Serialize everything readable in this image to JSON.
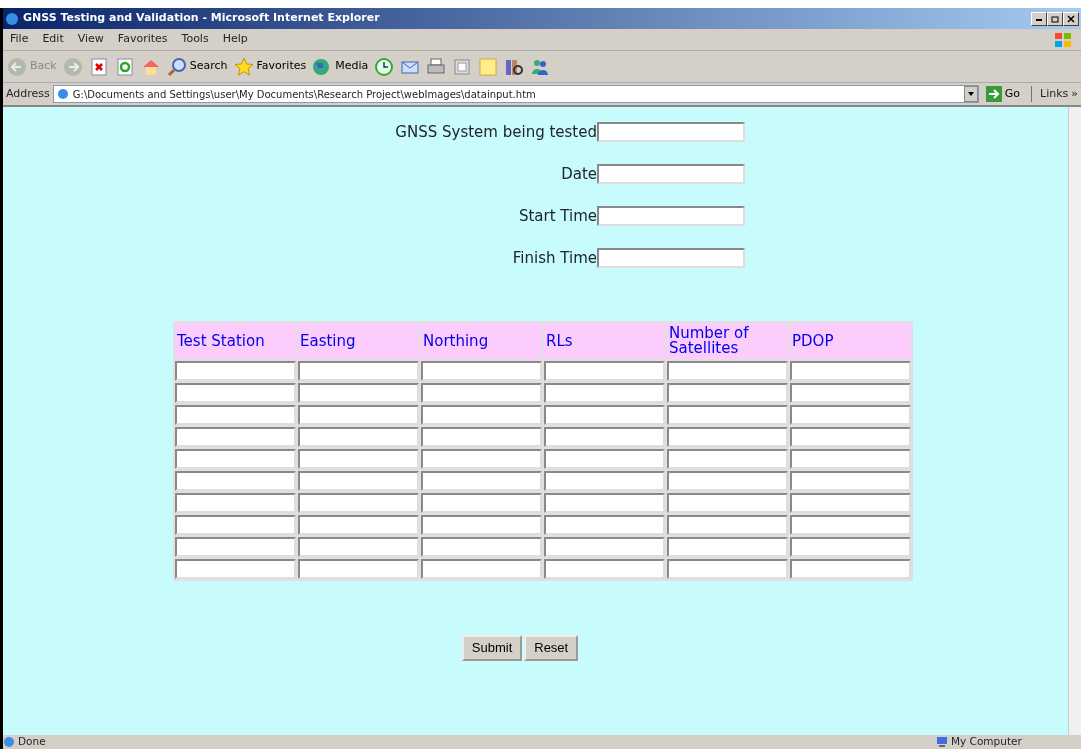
{
  "window": {
    "title": "GNSS Testing and Validation - Microsoft Internet Explorer"
  },
  "menu": [
    "File",
    "Edit",
    "View",
    "Favorites",
    "Tools",
    "Help"
  ],
  "toolbar": [
    {
      "kind": "back",
      "label": "Back",
      "disabled": true
    },
    {
      "kind": "forward",
      "disabled": true
    },
    {
      "kind": "stop"
    },
    {
      "kind": "refresh"
    },
    {
      "kind": "home"
    },
    {
      "kind": "search",
      "label": "Search"
    },
    {
      "kind": "favorites",
      "label": "Favorites"
    },
    {
      "kind": "media",
      "label": "Media"
    },
    {
      "kind": "history"
    },
    {
      "kind": "mail"
    },
    {
      "kind": "print"
    },
    {
      "kind": "edit"
    },
    {
      "kind": "note"
    },
    {
      "kind": "research"
    },
    {
      "kind": "messenger"
    }
  ],
  "address_bar": {
    "label": "Address",
    "value": "G:\\Documents and Settings\\user\\My Documents\\Research Project\\webImages\\datainput.htm",
    "go": "Go",
    "links": "Links",
    "more": "»"
  },
  "fields": [
    {
      "label": "GNSS System being tested"
    },
    {
      "label": "Date"
    },
    {
      "label": "Start Time"
    },
    {
      "label": "Finish Time"
    }
  ],
  "table": {
    "columns": [
      "Test Station",
      "Easting",
      "Northing",
      "RLs",
      "Number of Satellites",
      "PDOP"
    ],
    "rows": [
      {
        "kind": "inputs"
      },
      {
        "kind": "inputs"
      },
      {
        "kind": "inputs"
      },
      {
        "kind": "inputs"
      },
      {
        "kind": "inputs"
      },
      {
        "kind": "inputs"
      },
      {
        "kind": "inputs"
      },
      {
        "kind": "inputs"
      },
      {
        "kind": "inputs"
      },
      {
        "kind": "inputs"
      }
    ]
  },
  "buttons": [
    "Submit",
    "Reset"
  ],
  "status_bar": {
    "text": "Done",
    "zone": "My Computer"
  }
}
